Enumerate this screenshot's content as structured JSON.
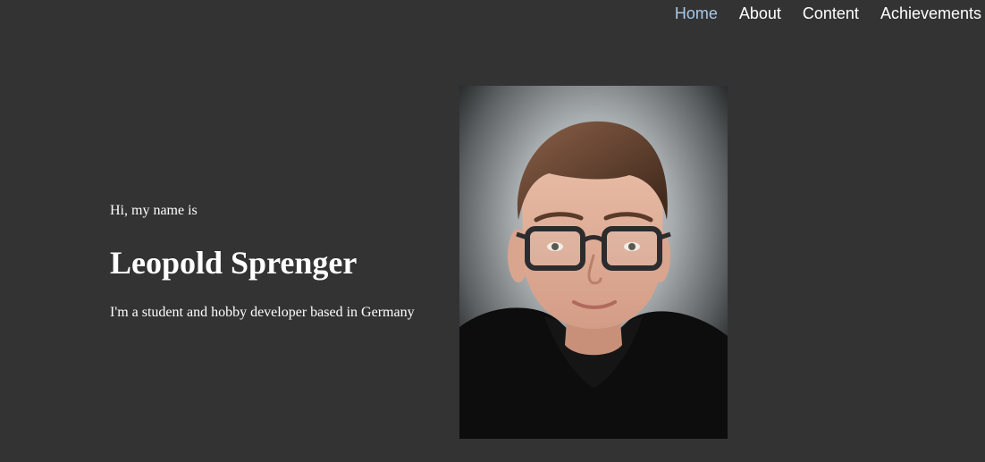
{
  "nav": {
    "items": [
      {
        "label": "Home",
        "active": true
      },
      {
        "label": "About",
        "active": false
      },
      {
        "label": "Content",
        "active": false
      },
      {
        "label": "Achievements",
        "active": false
      }
    ],
    "active_color": "#a9c8e6"
  },
  "hero": {
    "greeting": "Hi, my name is",
    "name": "Leopold Sprenger",
    "tagline": "I'm a student and hobby developer based in Germany"
  },
  "portrait": {
    "icon": "person-photo"
  },
  "colors": {
    "background": "#333333",
    "text": "#ffffff"
  }
}
